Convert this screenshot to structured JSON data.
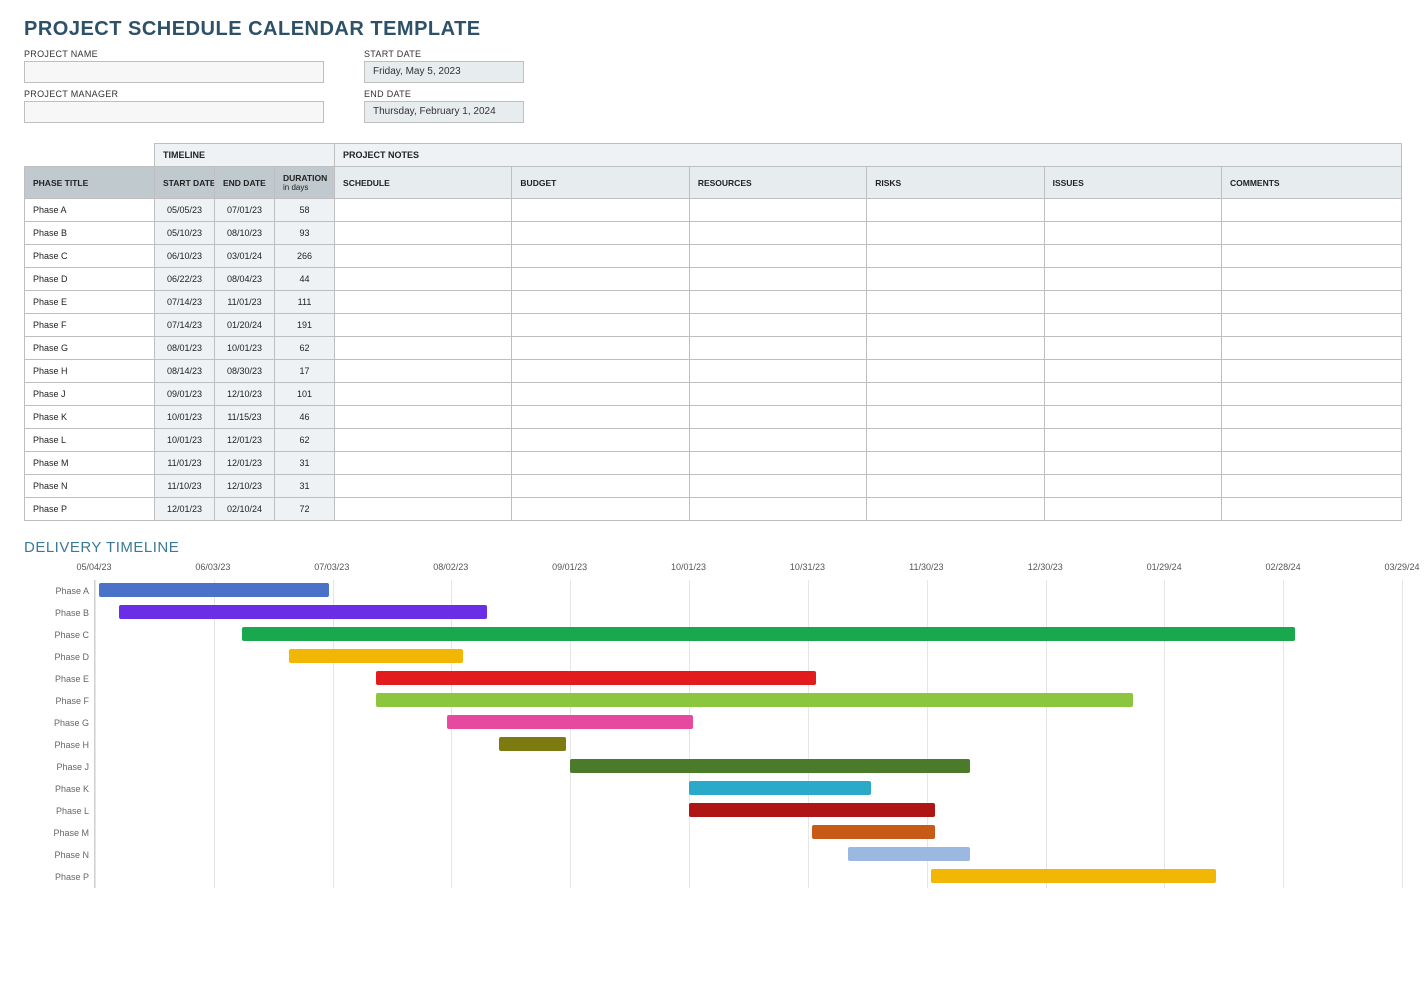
{
  "title": "PROJECT SCHEDULE CALENDAR TEMPLATE",
  "meta": {
    "project_name_label": "PROJECT NAME",
    "project_name_value": "",
    "project_manager_label": "PROJECT MANAGER",
    "project_manager_value": "",
    "start_date_label": "START DATE",
    "start_date_value": "Friday, May 5, 2023",
    "end_date_label": "END DATE",
    "end_date_value": "Thursday, February 1, 2024"
  },
  "table": {
    "group_timeline": "TIMELINE",
    "group_notes": "PROJECT NOTES",
    "col_phase": "PHASE TITLE",
    "col_start": "START DATE",
    "col_end": "END DATE",
    "col_duration": "DURATION",
    "col_duration_sub": "in days",
    "col_schedule": "SCHEDULE",
    "col_budget": "BUDGET",
    "col_resources": "RESOURCES",
    "col_risks": "RISKS",
    "col_issues": "ISSUES",
    "col_comments": "COMMENTS",
    "rows": [
      {
        "phase": "Phase A",
        "start": "05/05/23",
        "end": "07/01/23",
        "dur": "58"
      },
      {
        "phase": "Phase B",
        "start": "05/10/23",
        "end": "08/10/23",
        "dur": "93"
      },
      {
        "phase": "Phase C",
        "start": "06/10/23",
        "end": "03/01/24",
        "dur": "266"
      },
      {
        "phase": "Phase D",
        "start": "06/22/23",
        "end": "08/04/23",
        "dur": "44"
      },
      {
        "phase": "Phase E",
        "start": "07/14/23",
        "end": "11/01/23",
        "dur": "111"
      },
      {
        "phase": "Phase F",
        "start": "07/14/23",
        "end": "01/20/24",
        "dur": "191"
      },
      {
        "phase": "Phase G",
        "start": "08/01/23",
        "end": "10/01/23",
        "dur": "62"
      },
      {
        "phase": "Phase H",
        "start": "08/14/23",
        "end": "08/30/23",
        "dur": "17"
      },
      {
        "phase": "Phase J",
        "start": "09/01/23",
        "end": "12/10/23",
        "dur": "101"
      },
      {
        "phase": "Phase K",
        "start": "10/01/23",
        "end": "11/15/23",
        "dur": "46"
      },
      {
        "phase": "Phase L",
        "start": "10/01/23",
        "end": "12/01/23",
        "dur": "62"
      },
      {
        "phase": "Phase M",
        "start": "11/01/23",
        "end": "12/01/23",
        "dur": "31"
      },
      {
        "phase": "Phase N",
        "start": "11/10/23",
        "end": "12/10/23",
        "dur": "31"
      },
      {
        "phase": "Phase P",
        "start": "12/01/23",
        "end": "02/10/24",
        "dur": "72"
      }
    ]
  },
  "gantt_title": "DELIVERY TIMELINE",
  "chart_data": {
    "type": "bar",
    "title": "DELIVERY TIMELINE",
    "x_axis_labels": [
      "05/04/23",
      "06/03/23",
      "07/03/23",
      "08/02/23",
      "09/01/23",
      "10/01/23",
      "10/31/23",
      "11/30/23",
      "12/30/23",
      "01/29/24",
      "02/28/24",
      "03/29/24"
    ],
    "x_range_days": 330,
    "x_origin": "2023-05-04",
    "series": [
      {
        "name": "Phase A",
        "start": "2023-05-05",
        "end": "2023-07-01",
        "offset_days": 1,
        "duration_days": 58,
        "color": "#4a72c8"
      },
      {
        "name": "Phase B",
        "start": "2023-05-10",
        "end": "2023-08-10",
        "offset_days": 6,
        "duration_days": 93,
        "color": "#6a2ee6"
      },
      {
        "name": "Phase C",
        "start": "2023-06-10",
        "end": "2024-03-01",
        "offset_days": 37,
        "duration_days": 266,
        "color": "#1aa84f"
      },
      {
        "name": "Phase D",
        "start": "2023-06-22",
        "end": "2023-08-04",
        "offset_days": 49,
        "duration_days": 44,
        "color": "#f2b705"
      },
      {
        "name": "Phase E",
        "start": "2023-07-14",
        "end": "2023-11-01",
        "offset_days": 71,
        "duration_days": 111,
        "color": "#e21c1c"
      },
      {
        "name": "Phase F",
        "start": "2023-07-14",
        "end": "2024-01-20",
        "offset_days": 71,
        "duration_days": 191,
        "color": "#8cc63f"
      },
      {
        "name": "Phase G",
        "start": "2023-08-01",
        "end": "2023-10-01",
        "offset_days": 89,
        "duration_days": 62,
        "color": "#e64aa0"
      },
      {
        "name": "Phase H",
        "start": "2023-08-14",
        "end": "2023-08-30",
        "offset_days": 102,
        "duration_days": 17,
        "color": "#7d7a12"
      },
      {
        "name": "Phase J",
        "start": "2023-09-01",
        "end": "2023-12-10",
        "offset_days": 120,
        "duration_days": 101,
        "color": "#4a7a2a"
      },
      {
        "name": "Phase K",
        "start": "2023-10-01",
        "end": "2023-11-15",
        "offset_days": 150,
        "duration_days": 46,
        "color": "#2aa9c9"
      },
      {
        "name": "Phase L",
        "start": "2023-10-01",
        "end": "2023-12-01",
        "offset_days": 150,
        "duration_days": 62,
        "color": "#b01515"
      },
      {
        "name": "Phase M",
        "start": "2023-11-01",
        "end": "2023-12-01",
        "offset_days": 181,
        "duration_days": 31,
        "color": "#c85a17"
      },
      {
        "name": "Phase N",
        "start": "2023-11-10",
        "end": "2023-12-10",
        "offset_days": 190,
        "duration_days": 31,
        "color": "#9bb8e0"
      },
      {
        "name": "Phase P",
        "start": "2023-12-01",
        "end": "2024-02-10",
        "offset_days": 211,
        "duration_days": 72,
        "color": "#f2b705"
      }
    ]
  }
}
